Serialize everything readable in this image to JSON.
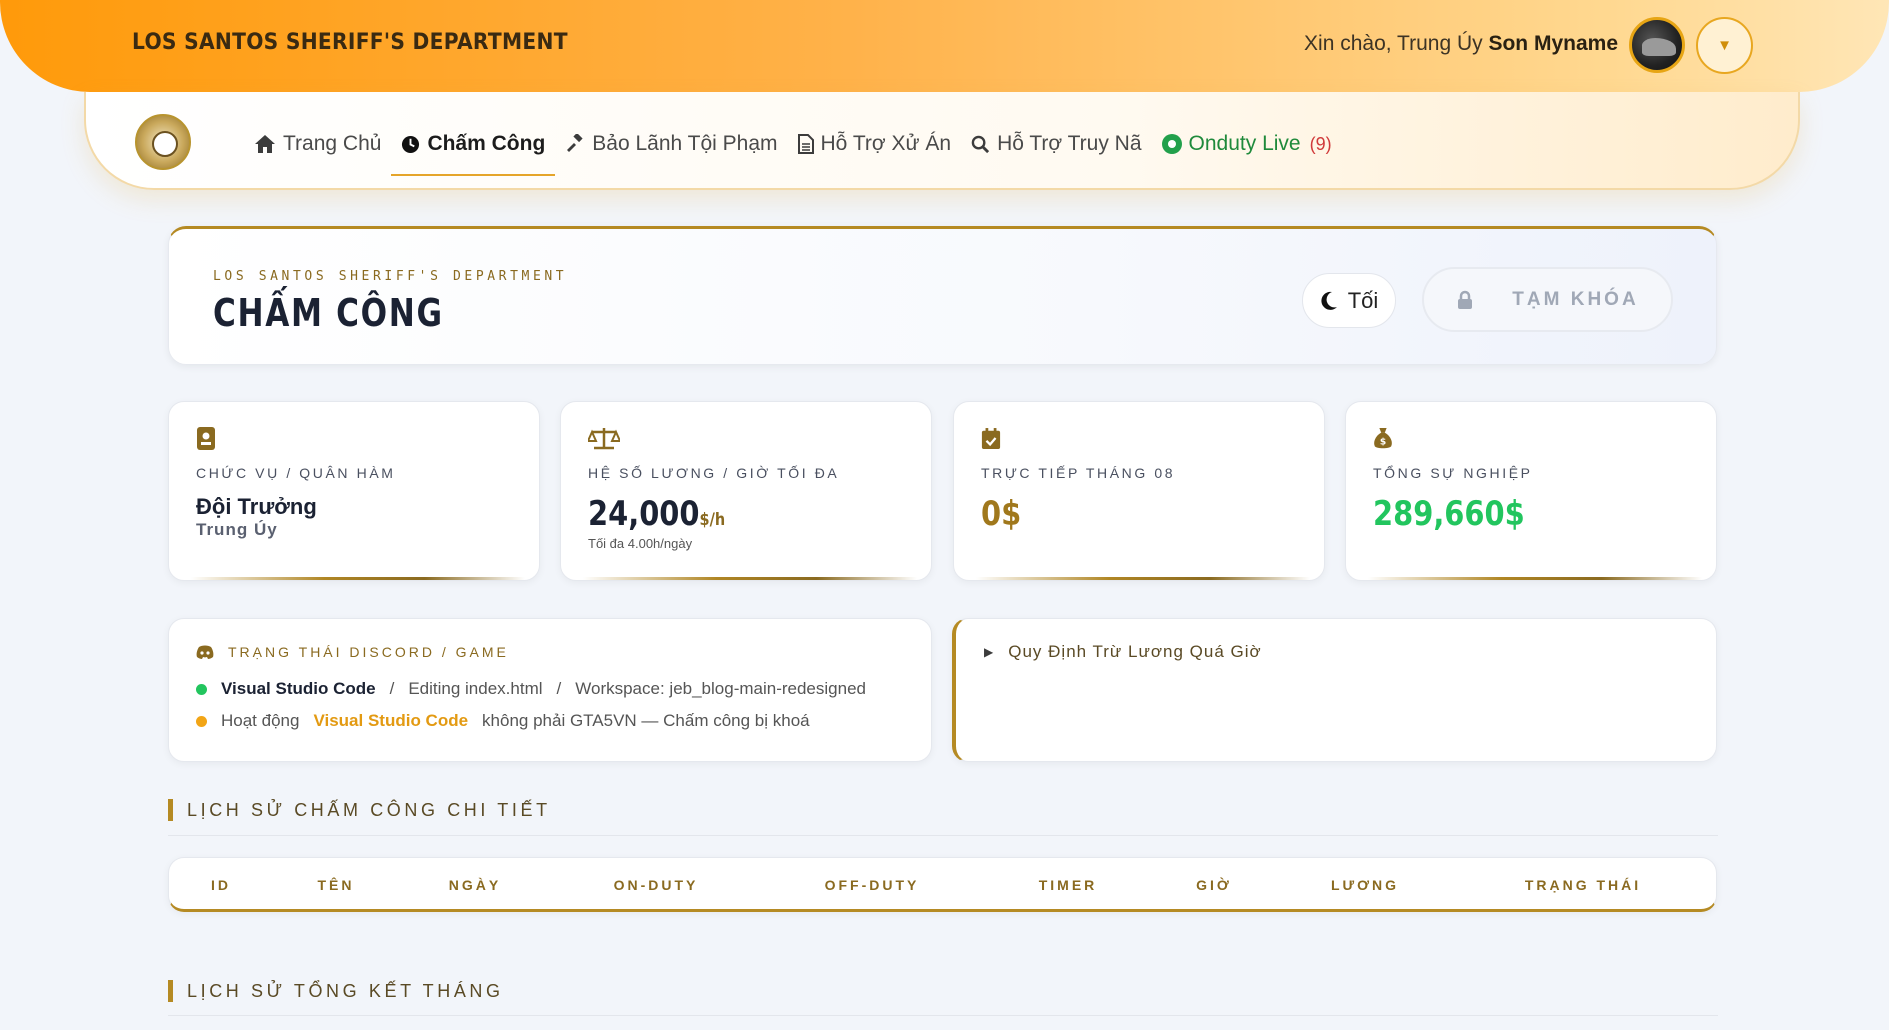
{
  "header": {
    "brand": "LOS SANTOS SHERIFF'S DEPARTMENT",
    "greeting_prefix": "Xin chào, Trung Úy",
    "user_name": "Son Myname"
  },
  "nav": {
    "items": [
      {
        "label": "Trang Chủ",
        "icon": "home-icon"
      },
      {
        "label": "Chấm Công",
        "icon": "clock-icon",
        "active": true
      },
      {
        "label": "Bảo Lãnh Tội Phạm",
        "icon": "gavel-icon"
      },
      {
        "label": "Hỗ Trợ Xử Án",
        "icon": "document-icon"
      },
      {
        "label": "Hỗ Trợ Truy Nã",
        "icon": "search-icon"
      }
    ],
    "live_label": "Onduty Live",
    "live_count": "(9)"
  },
  "hero": {
    "subtitle": "LOS SANTOS SHERIFF'S DEPARTMENT",
    "title": "CHẤM CÔNG",
    "theme_label": "Tối",
    "lock_label": "TẠM KHÓA"
  },
  "stats": {
    "position": {
      "label": "CHỨC VỤ / QUÂN HÀM",
      "name": "Đội Trưởng",
      "rank": "Trung Úy"
    },
    "salary": {
      "label": "HỆ SỐ LƯƠNG / GIỜ TỐI ĐA",
      "value": "24,000",
      "unit": "$/h",
      "sub": "Tối đa 4.00h/ngày"
    },
    "monthly": {
      "label": "TRỰC TIẾP THÁNG 08",
      "value": "0$"
    },
    "career": {
      "label": "TỔNG SỰ NGHIỆP",
      "value": "289,660$"
    }
  },
  "discord": {
    "title": "TRẠNG THÁI DISCORD / GAME",
    "line1": {
      "app": "Visual Studio Code",
      "sep": "/",
      "detail": "Editing index.html",
      "sep2": "/",
      "workspace": "Workspace: jeb_blog-main-redesigned"
    },
    "line2": {
      "prefix": "Hoạt động",
      "app": "Visual Studio Code",
      "suffix": "không phải GTA5VN — Chấm công bị khoá"
    }
  },
  "rules": {
    "title": "Quy Định Trừ Lương Quá Giờ"
  },
  "sections": {
    "history": "LỊCH SỬ CHẤM CÔNG CHI TIẾT",
    "monthly": "LỊCH SỬ TỔNG KẾT THÁNG"
  },
  "table": {
    "columns": [
      "ID",
      "TÊN",
      "NGÀY",
      "ON-DUTY",
      "OFF-DUTY",
      "TIMER",
      "GIỜ",
      "LƯƠNG",
      "TRẠNG THÁI"
    ]
  },
  "colors": {
    "accent": "#b58a23",
    "header_start": "#ff9a0a",
    "live_green": "#1f8a3b",
    "career_green": "#22c55e",
    "warning": "#e39a12"
  }
}
